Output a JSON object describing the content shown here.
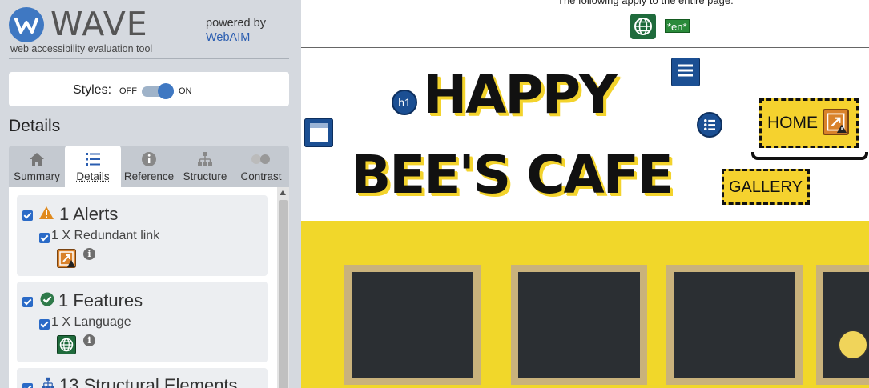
{
  "wave": {
    "logo_text": "WAVE",
    "subtitle": "web accessibility evaluation tool",
    "powered_by": "powered by",
    "webaim_link": "WebAIM",
    "styles_label": "Styles:",
    "styles_off": "OFF",
    "styles_on": "ON",
    "styles_enabled": true,
    "details_heading": "Details",
    "tabs": [
      {
        "label": "Summary",
        "icon": "home-icon"
      },
      {
        "label": "Details",
        "icon": "list-icon",
        "active": true
      },
      {
        "label": "Reference",
        "icon": "info-icon"
      },
      {
        "label": "Structure",
        "icon": "hierarchy-icon"
      },
      {
        "label": "Contrast",
        "icon": "contrast-icon"
      }
    ],
    "categories": [
      {
        "title": "1 Alerts",
        "icon": "alert-triangle-icon",
        "item": "1 X Redundant link",
        "item_icon": "redundant-link-icon"
      },
      {
        "title": "1 Features",
        "icon": "check-circle-icon",
        "item": "1 X Language",
        "item_icon": "language-globe-icon"
      },
      {
        "title": "13 Structural Elements",
        "icon": "hierarchy-icon"
      }
    ]
  },
  "preview": {
    "apply_text": "The following apply to the entire page:",
    "lang_tag": "*en*",
    "title_line1": "HAPPY",
    "title_line2": "BEE'S CAFE",
    "h1_badge": "h1",
    "nav_home": "HOME",
    "nav_gallery": "GALLERY"
  },
  "colors": {
    "wave_blue": "#3f78c2",
    "panel_bg": "#d5d9df",
    "cafe_yellow": "#f5d22e",
    "alert_orange": "#d9822b",
    "feature_green": "#1f6b3c"
  }
}
